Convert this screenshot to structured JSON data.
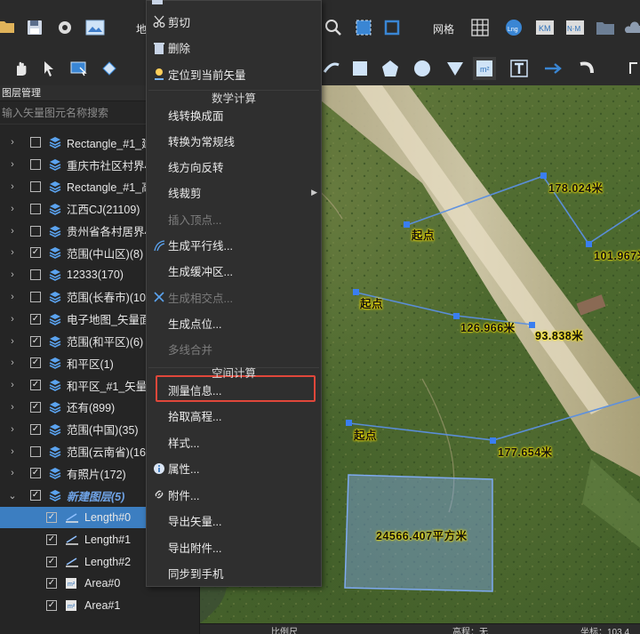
{
  "toolbar": {
    "map_label_partial": "地",
    "grid_label": "网格"
  },
  "panel": {
    "title": "图层管理",
    "search_placeholder": "输入矢量图元名称搜索",
    "layers": [
      {
        "label": "Rectangle_#1_建",
        "checked": false
      },
      {
        "label": "重庆市社区村界4",
        "checked": false
      },
      {
        "label": "Rectangle_#1_高",
        "checked": false
      },
      {
        "label": "江西CJ(21109)",
        "checked": false
      },
      {
        "label": "贵州省各村居界4",
        "checked": false
      },
      {
        "label": "范围(中山区)(8)",
        "checked": true
      },
      {
        "label": "12333(170)",
        "checked": false
      },
      {
        "label": "范围(长春市)(10)",
        "checked": false
      },
      {
        "label": "电子地图_矢量面",
        "checked": true
      },
      {
        "label": "范围(和平区)(6)",
        "checked": true
      },
      {
        "label": "和平区(1)",
        "checked": true
      },
      {
        "label": "和平区_#1_矢量数",
        "checked": true
      },
      {
        "label": "还有(899)",
        "checked": true
      },
      {
        "label": "范围(中国)(35)",
        "checked": true
      },
      {
        "label": "范围(云南省)(16)",
        "checked": false
      },
      {
        "label": "有照片(172)",
        "checked": true
      },
      {
        "label": "新建图层(5)",
        "checked": true
      }
    ],
    "children": [
      {
        "label": "Length#0",
        "selected": true
      },
      {
        "label": "Length#1",
        "selected": false
      },
      {
        "label": "Length#2",
        "selected": false
      },
      {
        "label": "Area#0",
        "selected": false
      },
      {
        "label": "Area#1",
        "selected": false
      }
    ]
  },
  "context_menu": {
    "items_top": [
      {
        "label": "剪切",
        "icon": "scissors-icon"
      },
      {
        "label": "删除",
        "icon": "trash-icon"
      },
      {
        "label": "定位到当前矢量",
        "icon": "locate-icon"
      }
    ],
    "section_math": "数学计算",
    "items_math": [
      {
        "label": "线转换成面",
        "disabled": false
      },
      {
        "label": "转换为常规线",
        "disabled": false
      },
      {
        "label": "线方向反转",
        "disabled": false
      },
      {
        "label": "线裁剪",
        "disabled": false,
        "submenu": true
      },
      {
        "label": "插入顶点...",
        "disabled": true
      },
      {
        "label": "生成平行线...",
        "disabled": false,
        "icon": "parallel-icon"
      },
      {
        "label": "生成缓冲区...",
        "disabled": false
      },
      {
        "label": "生成相交点...",
        "disabled": true,
        "icon": "intersect-icon"
      },
      {
        "label": "生成点位...",
        "disabled": false
      },
      {
        "label": "多线合并",
        "disabled": true
      }
    ],
    "section_space": "空间计算",
    "items_space": [
      {
        "label": "测量信息...",
        "highlighted": true
      },
      {
        "label": "拾取高程..."
      },
      {
        "label": "样式..."
      },
      {
        "label": "属性...",
        "icon": "info-icon"
      },
      {
        "label": "附件...",
        "icon": "link-icon"
      },
      {
        "label": "导出矢量..."
      },
      {
        "label": "导出附件..."
      },
      {
        "label": "同步到手机"
      }
    ]
  },
  "map": {
    "labels": {
      "start1": "起点",
      "start2": "起点",
      "start3": "起点",
      "d1": "178.024米",
      "d2": "101.967米",
      "d3": "126.966米",
      "d4": "93.838米",
      "d5": "177.654米",
      "area": "24566.407平方米"
    }
  },
  "statusbar": {
    "left": "比例尺",
    "mid": "高程：无",
    "right": "坐标：103.4"
  }
}
